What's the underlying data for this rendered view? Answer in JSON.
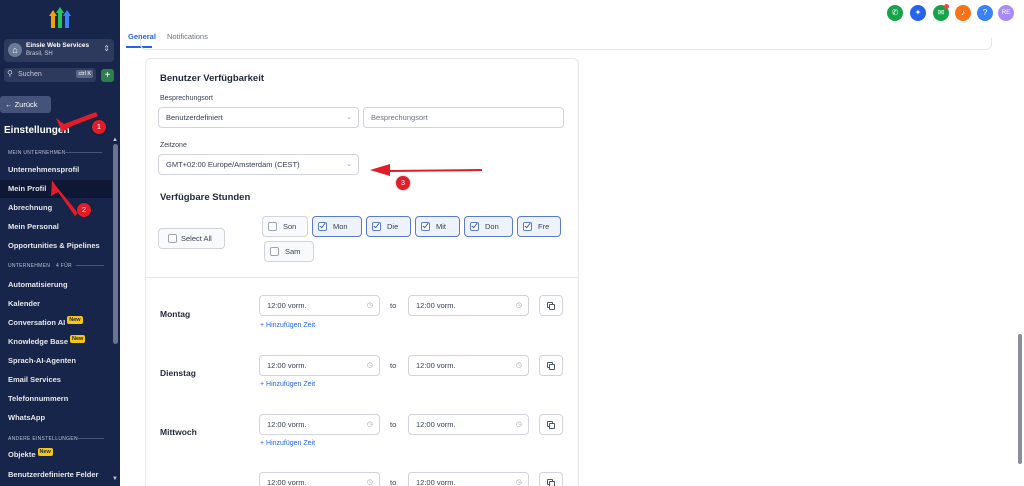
{
  "sidebar": {
    "account": {
      "name": "Einsle Web Services",
      "location": "Brasil, SH"
    },
    "search": {
      "label": "Suchen",
      "shortcut": "ctrl K"
    },
    "back_label": "← Zurück",
    "section_title": "Einstellungen",
    "group1_label": "MEIN UNTERNEHMEN",
    "group2_label": "UNTERNEHMEN",
    "group2_count": "4 FÜR",
    "group3_label": "ANDERE EINSTELLUNGEN",
    "new_badge": "New",
    "items": [
      {
        "label": "Unternehmensprofil"
      },
      {
        "label": "Mein Profil"
      },
      {
        "label": "Abrechnung"
      },
      {
        "label": "Mein Personal"
      },
      {
        "label": "Opportunities & Pipelines"
      },
      {
        "label": "Automatisierung"
      },
      {
        "label": "Kalender"
      },
      {
        "label": "Conversation AI"
      },
      {
        "label": "Knowledge Base"
      },
      {
        "label": "Sprach-AI-Agenten"
      },
      {
        "label": "Email Services"
      },
      {
        "label": "Telefonnummern"
      },
      {
        "label": "WhatsApp"
      },
      {
        "label": "Objekte"
      },
      {
        "label": "Benutzerdefinierte Felder"
      }
    ]
  },
  "tabs": {
    "general": "General",
    "notifications": "Notifications"
  },
  "topbar": {
    "user_initials": "RE"
  },
  "availability": {
    "title": "Benutzer Verfügbarkeit",
    "meeting_location_label": "Besprechungsort",
    "meeting_location_value": "Benutzerdefiniert",
    "meeting_location_placeholder": "Besprechungsort",
    "timezone_label": "Zeitzone",
    "timezone_value": "GMT+02:00 Europe/Amsterdam (CEST)"
  },
  "hours": {
    "title": "Verfügbare Stunden",
    "select_all": "Select All",
    "days": [
      {
        "label": "Son",
        "checked": false
      },
      {
        "label": "Mon",
        "checked": true
      },
      {
        "label": "Die",
        "checked": true
      },
      {
        "label": "Mit",
        "checked": true
      },
      {
        "label": "Don",
        "checked": true
      },
      {
        "label": "Fre",
        "checked": true
      },
      {
        "label": "Sam",
        "checked": false
      }
    ],
    "to_label": "to",
    "add_time": "+ Hinzufügen Zeit",
    "schedule": [
      {
        "day": "Montag",
        "from": "12:00 vorm.",
        "to": "12:00 vorm."
      },
      {
        "day": "Dienstag",
        "from": "12:00 vorm.",
        "to": "12:00 vorm."
      },
      {
        "day": "Mittwoch",
        "from": "12:00 vorm.",
        "to": "12:00 vorm."
      },
      {
        "day": "",
        "from": "12:00 vorm.",
        "to": "12:00 vorm."
      }
    ]
  },
  "annotations": {
    "step1": "1",
    "step2": "2",
    "step3": "3"
  },
  "colors": {
    "sidebar_bg": "#18254a",
    "accent": "#2563eb",
    "annotation": "#e11d2a"
  }
}
